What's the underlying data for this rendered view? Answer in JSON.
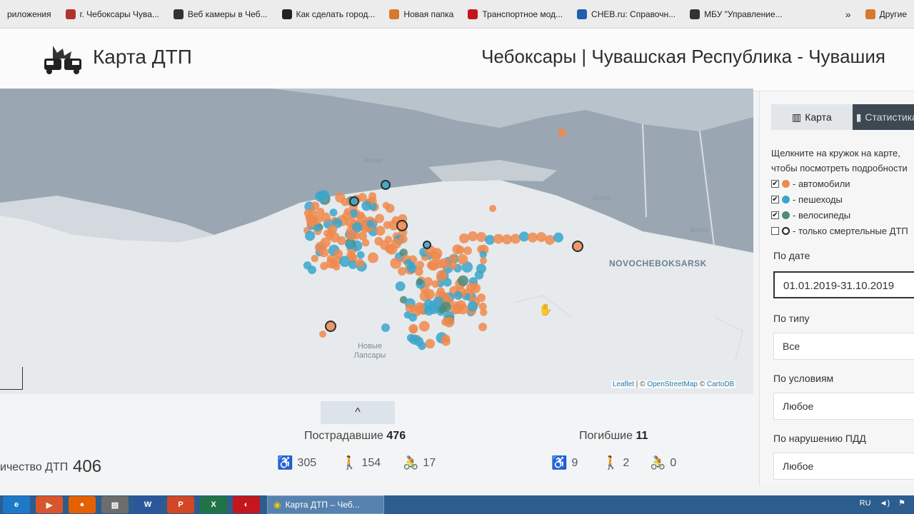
{
  "bookmarks": [
    {
      "label": "риложения",
      "color": "#ececec"
    },
    {
      "label": "г. Чебоксары Чува...",
      "color": "#b0322e"
    },
    {
      "label": "Веб камеры в Чеб...",
      "color": "#333333"
    },
    {
      "label": "Как сделать город...",
      "color": "#222222"
    },
    {
      "label": "Новая папка",
      "color": "#d9772c"
    },
    {
      "label": "Транспортное мод...",
      "color": "#c4161c"
    },
    {
      "label": "CHEB.ru: Справочн...",
      "color": "#1f5fae"
    },
    {
      "label": "МБУ \"Управление...",
      "color": "#333333"
    }
  ],
  "bookmarks_more": "»",
  "bookmarks_other": "Другие",
  "header": {
    "brand": "Карта ДТП",
    "region": "Чебоксары | Чувашская Республика - Чувашия"
  },
  "map": {
    "labels": {
      "river_1": "Волга",
      "river_2": "Волга",
      "river_3": "Волга",
      "city": "NOVOCHEBOKSARSK",
      "town_1": "Новые",
      "town_2": "Лапсары"
    },
    "attribution": {
      "leaflet": "Leaflet",
      "sep1": " | © ",
      "osm": "OpenStreetMap",
      "sep2": " © ",
      "carto": "CartoDB"
    },
    "colors": {
      "cars": "#ef8a4f",
      "pedestrians": "#3aa6cc",
      "cyclists": "#4e8b7a",
      "fatal_stroke": "#2b2b2b"
    }
  },
  "collapse_icon": "^",
  "stats": {
    "count_label": "ичество ДТП",
    "count_value": "406",
    "injured_label": "Пострадавшие",
    "injured_total": "476",
    "injured": {
      "drivers": "305",
      "pedestrians": "154",
      "cyclists": "17"
    },
    "killed_label": "Погибшие",
    "killed_total": "11",
    "killed": {
      "drivers": "9",
      "pedestrians": "2",
      "cyclists": "0"
    }
  },
  "panel": {
    "tab_map": "Карта",
    "tab_stats": "Статистика",
    "hint_line1": "Щелкните на кружок на карте,",
    "hint_line2": "чтобы посмотреть подробности",
    "legend": [
      {
        "label": "- автомобили",
        "checked": true,
        "color": "#ef8a4f",
        "fatal": false
      },
      {
        "label": "- пешеходы",
        "checked": true,
        "color": "#3aa6cc",
        "fatal": false
      },
      {
        "label": "- велосипеды",
        "checked": true,
        "color": "#4e8b7a",
        "fatal": false
      },
      {
        "label": "- только смертельные ДТП",
        "checked": false,
        "color": "#ffffff",
        "fatal": true
      }
    ],
    "filter_date_label": "По дате",
    "filter_date_value": "01.01.2019-31.10.2019",
    "filter_type_label": "По типу",
    "filter_type_value": "Все",
    "filter_cond_label": "По условиям",
    "filter_cond_value": "Любое",
    "filter_viol_label": "По нарушению ПДД",
    "filter_viol_value": "Любое"
  },
  "taskbar": {
    "apps": [
      {
        "name": "ie",
        "color": "#1e78c8",
        "glyph": "e"
      },
      {
        "name": "media",
        "color": "#d9552b",
        "glyph": "▶"
      },
      {
        "name": "firefox",
        "color": "#e66000",
        "glyph": "●"
      },
      {
        "name": "explorer",
        "color": "#6d6d6d",
        "glyph": "▤"
      },
      {
        "name": "word",
        "color": "#2b579a",
        "glyph": "W"
      },
      {
        "name": "powerpoint",
        "color": "#d24726",
        "glyph": "P"
      },
      {
        "name": "excel",
        "color": "#217346",
        "glyph": "X"
      },
      {
        "name": "app",
        "color": "#c4161c",
        "glyph": "◐"
      }
    ],
    "active_title": "Карта ДТП – Чеб...",
    "lang": "RU"
  }
}
